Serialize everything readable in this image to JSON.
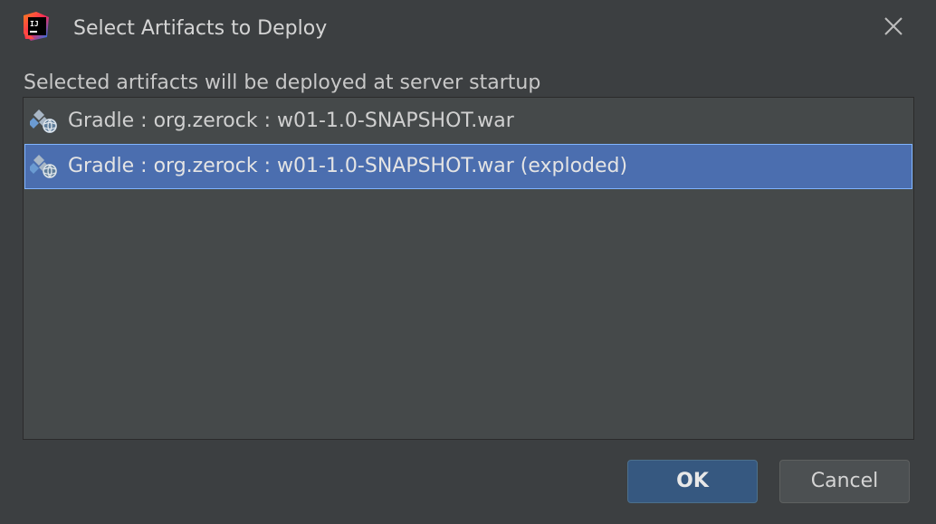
{
  "window": {
    "title": "Select Artifacts to Deploy",
    "app_icon": "intellij-idea-icon",
    "close_icon": "close-icon"
  },
  "description": "Selected artifacts will be deployed at server startup",
  "artifacts": [
    {
      "label": "Gradle : org.zerock : w01-1.0-SNAPSHOT.war",
      "icon": "web-artifact-icon",
      "selected": false
    },
    {
      "label": "Gradle : org.zerock : w01-1.0-SNAPSHOT.war (exploded)",
      "icon": "web-artifact-icon",
      "selected": true
    }
  ],
  "buttons": {
    "ok": "OK",
    "cancel": "Cancel"
  },
  "colors": {
    "background": "#3c3f41",
    "list_background": "#45494a",
    "selection": "#4b6eaf",
    "selection_border": "#80b4ff",
    "ok_button": "#365880",
    "cancel_button": "#4c5052"
  }
}
